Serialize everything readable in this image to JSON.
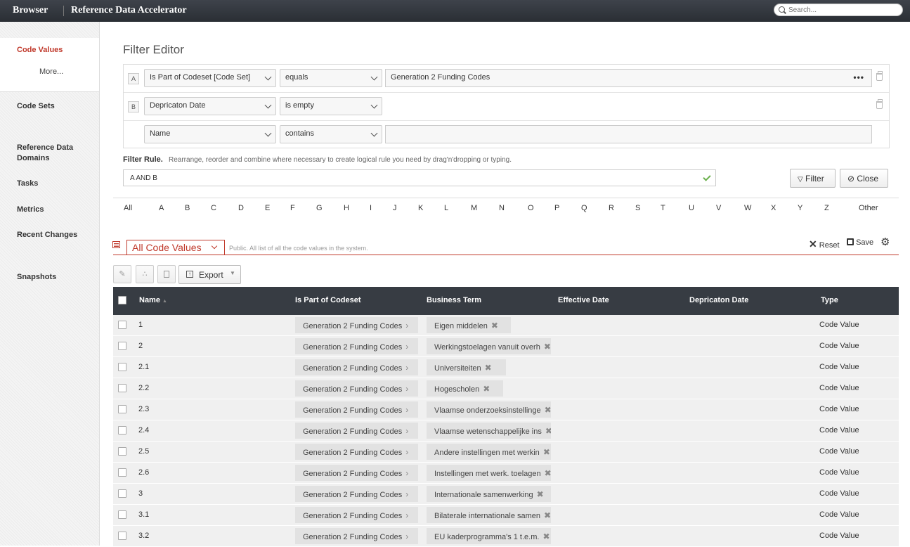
{
  "header": {
    "brand": "Browser",
    "app_title": "Reference Data Accelerator",
    "search_placeholder": "Search..."
  },
  "sidebar": {
    "active_item": "Code Values",
    "more": "More...",
    "items": [
      "Code Sets",
      "Reference Data Domains",
      "Tasks",
      "Metrics",
      "Recent Changes",
      "Snapshots"
    ]
  },
  "filter_editor": {
    "title": "Filter Editor",
    "rows": [
      {
        "letter": "A",
        "field": "Is Part of Codeset [Code Set]",
        "operator": "equals",
        "value": "Generation 2 Funding Codes",
        "more": "•••"
      },
      {
        "letter": "B",
        "field": "Depricaton Date",
        "operator": "is empty",
        "value": ""
      },
      {
        "letter": "",
        "field": "Name",
        "operator": "contains",
        "value": ""
      }
    ],
    "rule_label": "Filter Rule.",
    "rule_hint": "Rearrange, reorder and combine where necessary to create logical rule you need by drag'n'dropping or typing.",
    "rule_value": "A AND B",
    "filter_button": "Filter",
    "close_button": "Close"
  },
  "alphabet": [
    "All",
    "A",
    "B",
    "C",
    "D",
    "E",
    "F",
    "G",
    "H",
    "I",
    "J",
    "K",
    "L",
    "M",
    "N",
    "O",
    "P",
    "Q",
    "R",
    "S",
    "T",
    "U",
    "V",
    "W",
    "X",
    "Y",
    "Z",
    "Other"
  ],
  "view": {
    "name": "All Code Values",
    "description": "Public. All list of all the code values in the system.",
    "reset": "Reset",
    "save": "Save"
  },
  "toolbar": {
    "export": "Export"
  },
  "table": {
    "columns": [
      "Name",
      "Is Part of Codeset",
      "Business Term",
      "Effective Date",
      "Depricaton Date",
      "Type"
    ],
    "rows": [
      {
        "name": "1",
        "codeset": "Generation 2 Funding Codes",
        "term": "Eigen middelen",
        "type": "Code Value"
      },
      {
        "name": "2",
        "codeset": "Generation 2 Funding Codes",
        "term": "Werkingstoelagen vanuit overh",
        "type": "Code Value"
      },
      {
        "name": "2.1",
        "codeset": "Generation 2 Funding Codes",
        "term": "Universiteiten",
        "type": "Code Value"
      },
      {
        "name": "2.2",
        "codeset": "Generation 2 Funding Codes",
        "term": "Hogescholen",
        "type": "Code Value"
      },
      {
        "name": "2.3",
        "codeset": "Generation 2 Funding Codes",
        "term": "Vlaamse onderzoeksinstellinge",
        "type": "Code Value"
      },
      {
        "name": "2.4",
        "codeset": "Generation 2 Funding Codes",
        "term": "Vlaamse wetenschappelijke ins",
        "type": "Code Value"
      },
      {
        "name": "2.5",
        "codeset": "Generation 2 Funding Codes",
        "term": "Andere instellingen met werkin",
        "type": "Code Value"
      },
      {
        "name": "2.6",
        "codeset": "Generation 2 Funding Codes",
        "term": "Instellingen met werk. toelagen",
        "type": "Code Value"
      },
      {
        "name": "3",
        "codeset": "Generation 2 Funding Codes",
        "term": "Internationale samenwerking",
        "type": "Code Value"
      },
      {
        "name": "3.1",
        "codeset": "Generation 2 Funding Codes",
        "term": "Bilaterale internationale samen",
        "type": "Code Value"
      },
      {
        "name": "3.2",
        "codeset": "Generation 2 Funding Codes",
        "term": "EU kaderprogramma's 1 t.e.m.",
        "type": "Code Value"
      }
    ]
  }
}
